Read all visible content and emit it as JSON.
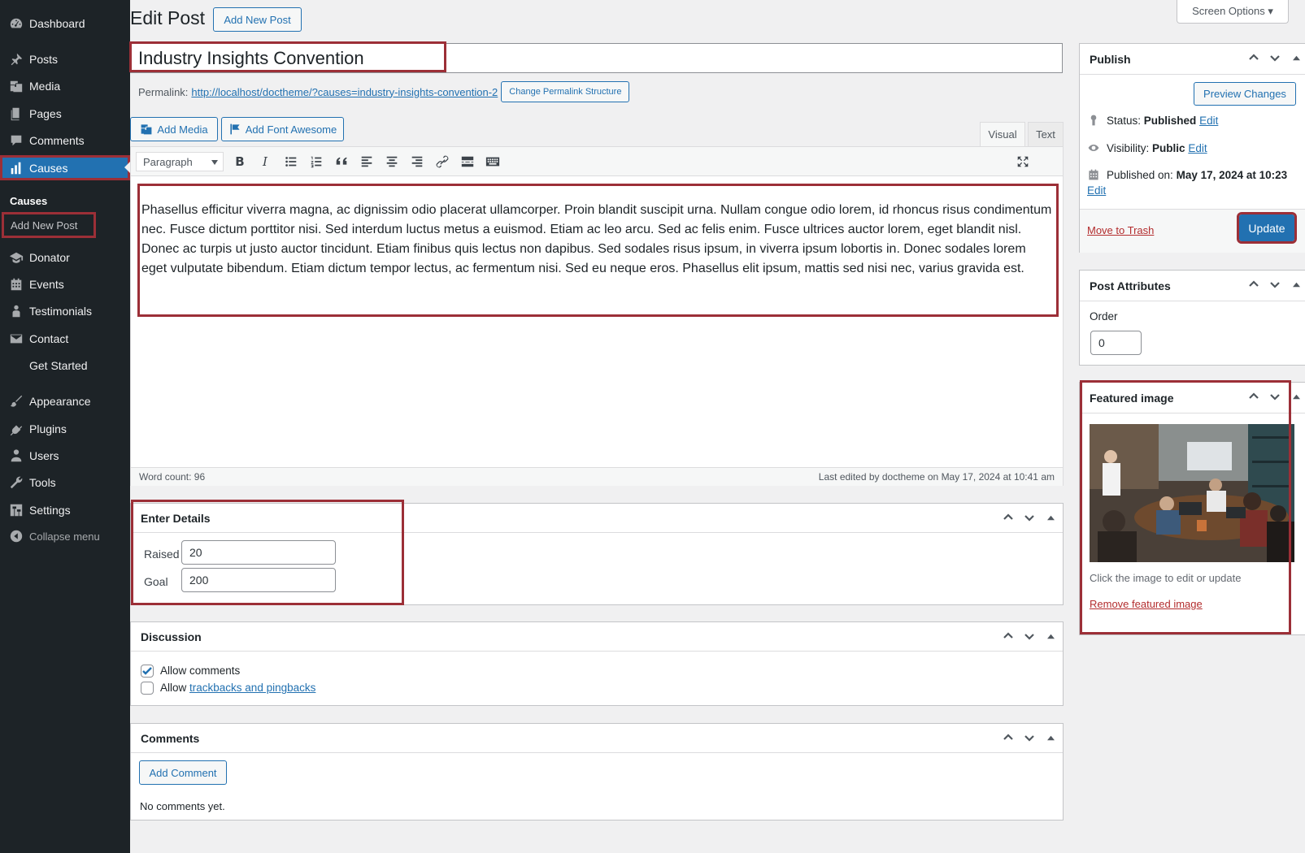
{
  "sidebar": {
    "items": [
      {
        "label": "Dashboard",
        "icon": "dashboard-icon"
      },
      {
        "label": "Posts",
        "icon": "pin-icon"
      },
      {
        "label": "Media",
        "icon": "media-icon"
      },
      {
        "label": "Pages",
        "icon": "pages-icon"
      },
      {
        "label": "Comments",
        "icon": "comments-icon"
      },
      {
        "label": "Causes",
        "icon": "chart-bar-icon"
      },
      {
        "label": "Donator",
        "icon": "education-icon"
      },
      {
        "label": "Events",
        "icon": "calendar-icon"
      },
      {
        "label": "Testimonials",
        "icon": "person-icon"
      },
      {
        "label": "Contact",
        "icon": "email-icon"
      },
      {
        "label": "Get Started",
        "icon": ""
      },
      {
        "label": "Appearance",
        "icon": "brush-icon"
      },
      {
        "label": "Plugins",
        "icon": "plugin-icon"
      },
      {
        "label": "Users",
        "icon": "users-icon"
      },
      {
        "label": "Tools",
        "icon": "wrench-icon"
      },
      {
        "label": "Settings",
        "icon": "settings-icon"
      }
    ],
    "submenu_head": "Causes",
    "submenu_item": "Add New Post",
    "collapse": "Collapse menu"
  },
  "header": {
    "title": "Edit Post",
    "add_new": "Add New Post",
    "screen_options": "Screen Options ▾"
  },
  "post": {
    "title": "Industry Insights Convention",
    "permalink_label": "Permalink:",
    "permalink_url": "http://localhost/doctheme/?causes=industry-insights-convention-2",
    "permalink_button": "Change Permalink Structure",
    "content": "Phasellus efficitur viverra magna, ac dignissim odio placerat ullamcorper. Proin blandit suscipit urna. Nullam congue odio lorem, id rhoncus risus condimentum nec. Fusce dictum porttitor nisi. Sed interdum luctus metus a euismod. Etiam ac leo arcu. Sed ac felis enim. Fusce ultrices auctor lorem, eget blandit nisl. Donec ac turpis ut justo auctor tincidunt. Etiam finibus quis lectus non dapibus. Sed sodales risus ipsum, in viverra ipsum lobortis in. Donec sodales lorem eget vulputate bibendum. Etiam dictum tempor lectus, ac fermentum nisi. Sed eu neque eros. Phasellus elit ipsum, mattis sed nisi nec, varius gravida est.",
    "word_count": "Word count: 96",
    "last_edited": "Last edited by doctheme on May 17, 2024 at 10:41 am"
  },
  "editor": {
    "add_media": "Add Media",
    "add_font_awesome": "Add Font Awesome",
    "tab_visual": "Visual",
    "tab_text": "Text",
    "format": "Paragraph"
  },
  "details": {
    "title": "Enter Details",
    "raised_label": "Raised",
    "raised_value": "20",
    "goal_label": "Goal",
    "goal_value": "200"
  },
  "discussion": {
    "title": "Discussion",
    "allow_comments": "Allow comments",
    "allow_prefix": "Allow",
    "trackbacks_link": "trackbacks and pingbacks",
    "allow_comments_checked": true,
    "trackbacks_checked": false
  },
  "comments": {
    "title": "Comments",
    "add_comment": "Add Comment",
    "none": "No comments yet."
  },
  "publish": {
    "title": "Publish",
    "preview": "Preview Changes",
    "status_label": "Status:",
    "status_value": "Published",
    "visibility_label": "Visibility:",
    "visibility_value": "Public",
    "edit": "Edit",
    "published_on_label": "Published on:",
    "published_on_value": "May 17, 2024 at 10:23",
    "trash": "Move to Trash",
    "update": "Update"
  },
  "attributes": {
    "title": "Post Attributes",
    "order_label": "Order",
    "order_value": "0"
  },
  "featured": {
    "title": "Featured image",
    "hint": "Click the image to edit or update",
    "remove": "Remove featured image"
  },
  "colors": {
    "sidebar_bg": "#1d2327",
    "accent": "#2271b1",
    "highlight": "#9c2f37",
    "trash": "#b32d2e"
  }
}
